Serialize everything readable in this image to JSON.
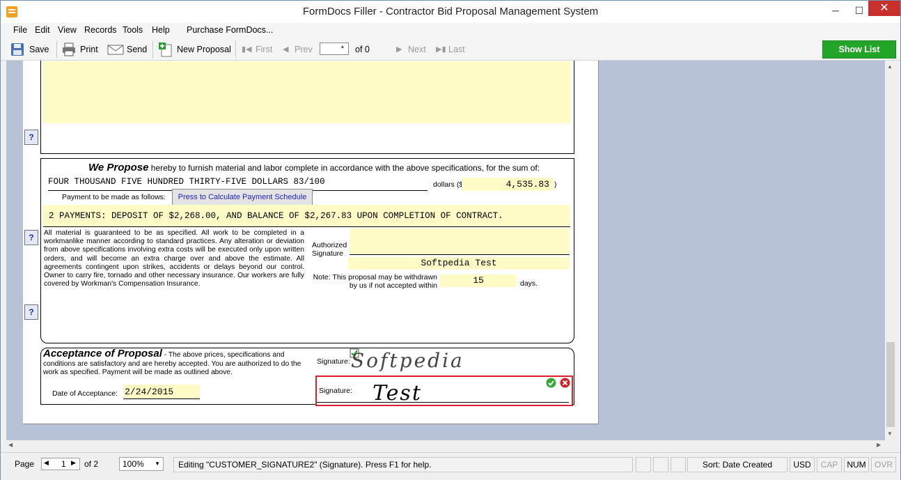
{
  "window": {
    "title": "FormDocs Filler - Contractor Bid Proposal Management System",
    "minimize": "─",
    "maximize": "☐",
    "close": "✕"
  },
  "menu": [
    "File",
    "Edit",
    "View",
    "Records",
    "Tools",
    "Help",
    "Purchase FormDocs..."
  ],
  "toolbar": {
    "save": "Save",
    "print": "Print",
    "send": "Send",
    "new_proposal": "New Proposal",
    "first": "First",
    "prev": "Prev",
    "record_value": "*",
    "record_of": "of 0",
    "next": "Next",
    "last": "Last",
    "show_list": "Show List"
  },
  "form": {
    "help_glyph": "?",
    "propose_heading": "We Propose",
    "propose_text": "hereby to furnish material and labor complete in accordance with the above specifications, for the sum of:",
    "amount_words": "FOUR THOUSAND FIVE HUNDRED THIRTY-FIVE DOLLARS 83/100",
    "dollars_label": "dollars ($",
    "amount": "4,535.83",
    "close_paren": ")",
    "payment_label": "Payment to be made as follows:",
    "calc_button": "Press to Calculate Payment Schedule",
    "payment_terms": "2 PAYMENTS: DEPOSIT OF $2,268.00, AND BALANCE OF $2,267.83 UPON COMPLETION OF CONTRACT.",
    "material_text": "All material is guaranteed to be as specified. All work to be completed in a workmanlike manner according to standard practices. Any alteration or deviation from above specifications involving extra costs will be executed only upon written orders, and will become an extra charge over and above the estimate. All agreements contingent upon strikes, accidents or delays beyond our control. Owner to carry fire, tornado and other necessary insurance. Our workers are fully covered by Workman's Compensation Insurance.",
    "authorized_label": "Authorized Signature",
    "authorized_name": "Softpedia Test",
    "note_label": "Note: This proposal may be withdrawn by us if not accepted within",
    "days_value": "15",
    "days_label": "days.",
    "acceptance_heading": "Acceptance of Proposal",
    "acceptance_text": "- The above prices, specifications and conditions are satisfactory and are hereby accepted. You are authorized to do the work as specified. Payment will be made as outlined above.",
    "signature_label_1": "Signature:",
    "signature_ink_1": "Softpedia",
    "signature_label_2": "Signature:",
    "signature_ink_2": "Test",
    "date_label": "Date of Acceptance:",
    "date_value": "2/24/2015"
  },
  "status": {
    "page_label": "Page",
    "page_value": "1",
    "page_of": "of 2",
    "zoom": "100%",
    "message": "Editing \"CUSTOMER_SIGNATURE2\" (Signature). Press F1 for help.",
    "sort": "Sort: Date Created",
    "currency": "USD",
    "cap": "CAP",
    "num": "NUM",
    "ovr": "OVR"
  },
  "colors": {
    "field_yellow": "#fffbc7",
    "show_list_green": "#23a52a",
    "active_border": "#e0202a"
  }
}
